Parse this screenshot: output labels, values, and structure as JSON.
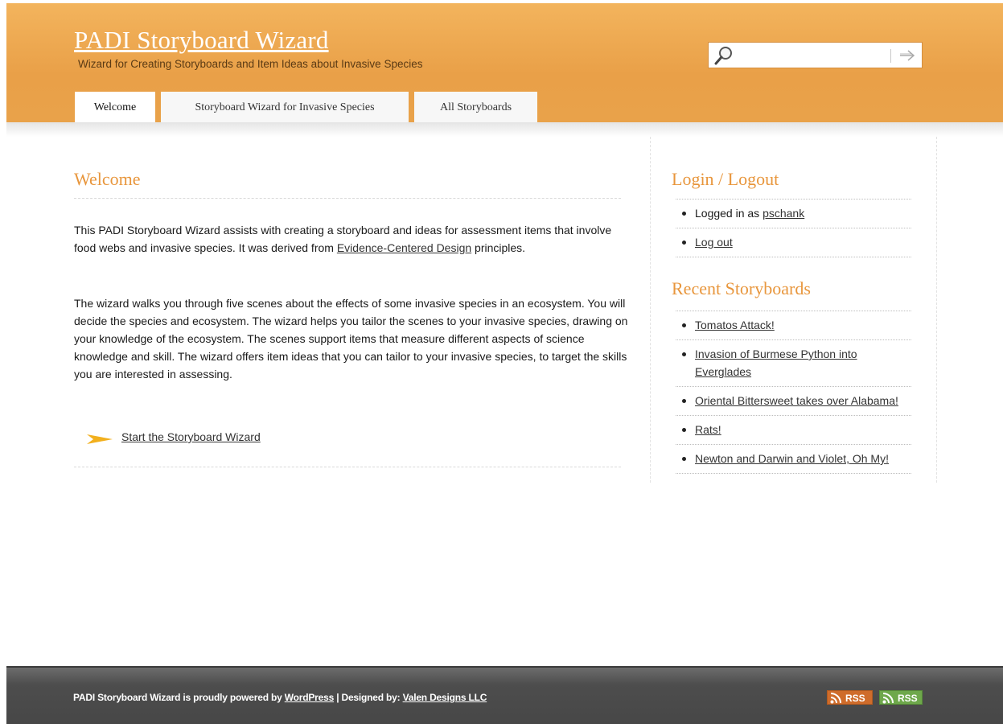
{
  "header": {
    "site_title": "PADI Storyboard Wizard",
    "site_description": "Wizard for Creating Storyboards and Item Ideas about Invasive Species",
    "search": {
      "value": "",
      "placeholder": ""
    },
    "tabs": [
      {
        "label": "Welcome",
        "active": true
      },
      {
        "label": "Storyboard Wizard for Invasive Species",
        "active": false
      },
      {
        "label": "All Storyboards",
        "active": false
      }
    ]
  },
  "main": {
    "heading": "Welcome",
    "para1_before": "This PADI Storyboard Wizard assists with creating a storyboard and ideas for assessment items that involve food webs and invasive species. It was derived from ",
    "para1_link": "Evidence-Centered Design",
    "para1_after": " principles.",
    "para2": "The wizard walks you through five scenes about the effects of some invasive species in an ecosystem.  You will decide the species and ecosystem. The wizard helps you tailor the scenes to your invasive species, drawing on your knowledge of the ecosystem. The scenes support items that measure different aspects of science knowledge and skill. The wizard offers item ideas that you can tailor to your invasive species, to target the skills you are interested in assessing.",
    "start_link": "Start the Storyboard Wizard"
  },
  "sidebar": {
    "login_heading": "Login / Logout",
    "logged_in_prefix": "Logged in as ",
    "username": "pschank",
    "logout_label": "Log out",
    "recent_heading": "Recent Storyboards",
    "recent": [
      "Tomatos Attack!",
      "Invasion of Burmese Python into Everglades",
      "Oriental Bittersweet takes over Alabama!",
      "Rats!",
      "Newton and Darwin and Violet, Oh My!"
    ]
  },
  "footer": {
    "text_prefix": "PADI Storyboard Wizard is proudly powered by ",
    "wordpress_link": "WordPress",
    "text_middle": " | Designed by: ",
    "designer_link": "Valen Designs LLC",
    "rss_label_1": "RSS",
    "rss_label_2": "RSS"
  },
  "colors": {
    "header_orange": "#e9a048",
    "heading_orange": "#e8963c",
    "footer_gray": "#4d4d4d",
    "rss_orange": "#cf6c2b",
    "rss_green": "#6ea84b"
  }
}
